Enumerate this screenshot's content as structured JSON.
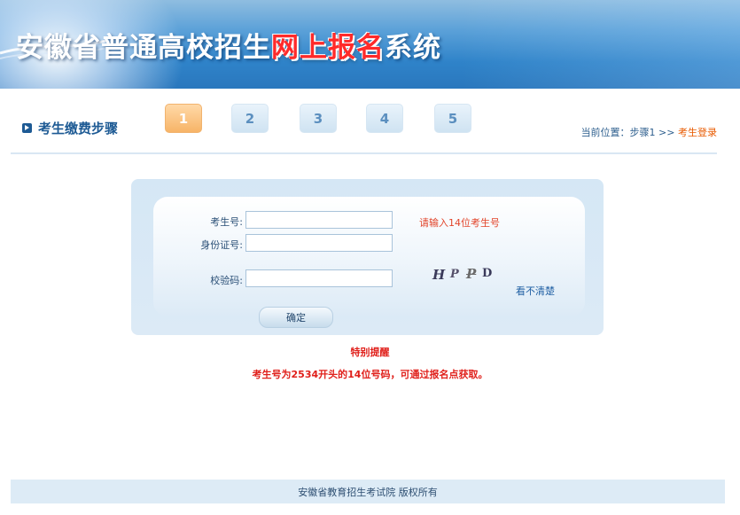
{
  "header": {
    "title_pre": "安徽省普通高校招生",
    "title_highlight": "网上报名",
    "title_post": "系统"
  },
  "steps": {
    "title": "考生缴费步骤",
    "items": [
      "1",
      "2",
      "3",
      "4",
      "5"
    ],
    "active_index": 0
  },
  "breadcrumb": {
    "prefix": "当前位置：步骤1 >> ",
    "current": "考生登录"
  },
  "form": {
    "exam_no_label": "考生号:",
    "exam_no_value": "",
    "exam_no_hint": "请输入14位考生号",
    "id_card_label": "身份证号:",
    "id_card_value": "",
    "captcha_label": "校验码:",
    "captcha_value": "",
    "captcha_image_text": "HPPD",
    "refresh_captcha": "看不清楚",
    "submit_label": "确定"
  },
  "notice": {
    "title": "特别提醒",
    "text": "考生号为2534开头的14位号码，可通过报名点获取。"
  },
  "footer": {
    "copyright": "安徽省教育招生考试院 版权所有"
  },
  "colors": {
    "accent_blue": "#1d5a94",
    "active_step": "#f7b467",
    "alert_red": "#e0201b",
    "crumb_orange": "#e85a00"
  }
}
